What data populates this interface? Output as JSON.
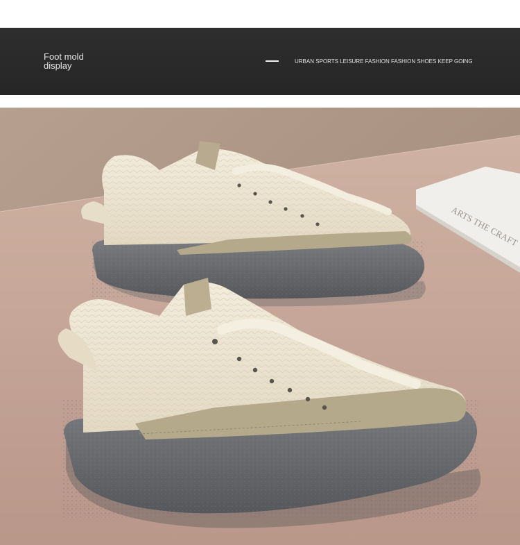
{
  "banner": {
    "title": "Foot mold\ndisplay",
    "tagline": "URBAN SPORTS LEISURE FASHION FASHION SHOES KEEP GOING"
  },
  "book": {
    "cover_text": "ARTS THE CRAFT"
  },
  "colors": {
    "banner_bg": "#2b2b2b",
    "shoe_upper": "#ebe3d0",
    "shoe_accent": "#b5a98c",
    "sole": "#6b6d70",
    "table": "#c7a795",
    "wall": "#a89282"
  }
}
